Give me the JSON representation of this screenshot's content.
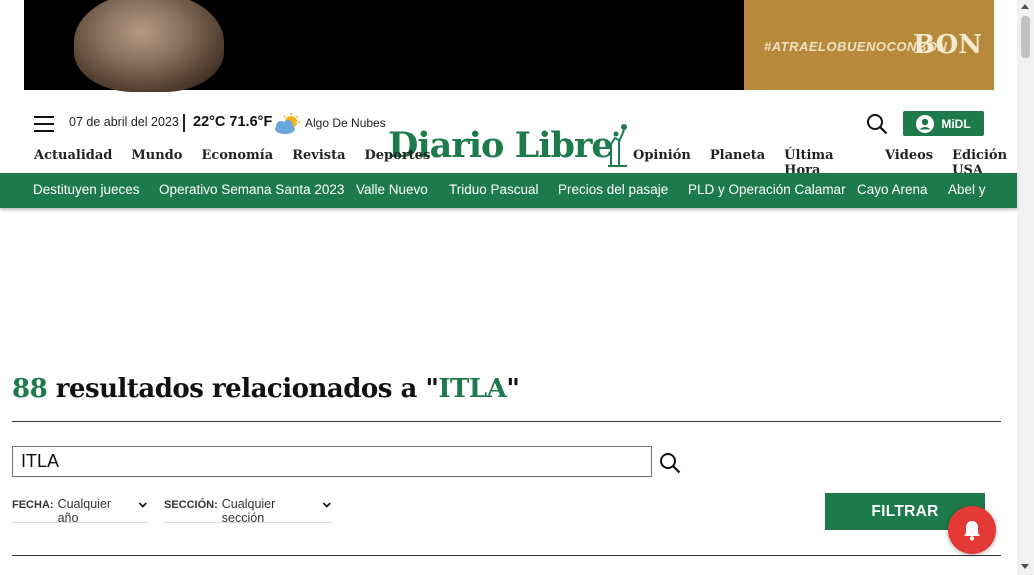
{
  "banner": {
    "hashtag": "#ATRAELOBUENOCONBON",
    "brand": "BON"
  },
  "header": {
    "date": "07 de abril del 2023",
    "temperature": "22°C 71.6°F",
    "weather": "Algo De Nubes",
    "logo": "Diario Libre",
    "midl_label": "MiDL",
    "nav_left": [
      "Actualidad",
      "Mundo",
      "Economía",
      "Revista",
      "Deportes"
    ],
    "nav_right": [
      "Opinión",
      "Planeta",
      "Última Hora",
      "Videos",
      "Edición USA"
    ]
  },
  "trending": [
    "Destituyen jueces",
    "Operativo Semana Santa 2023",
    "Valle Nuevo",
    "Triduo Pascual",
    "Precios del pasaje",
    "PLD y Operación Calamar",
    "Cayo Arena",
    "Abel y"
  ],
  "results": {
    "count": "88",
    "text": " resultados relacionados a \"",
    "query": "ITLA",
    "close_quote": "\""
  },
  "search": {
    "value": "ITLA"
  },
  "filters": {
    "fecha_label": "FECHA:",
    "fecha_value": "Cualquier año",
    "seccion_label": "SECCIÓN:",
    "seccion_value": "Cualquier sección",
    "button": "FILTRAR"
  },
  "colors": {
    "brand_green": "#1d7a4b",
    "notification_red": "#e53935",
    "banner_gold": "#b7893a"
  }
}
